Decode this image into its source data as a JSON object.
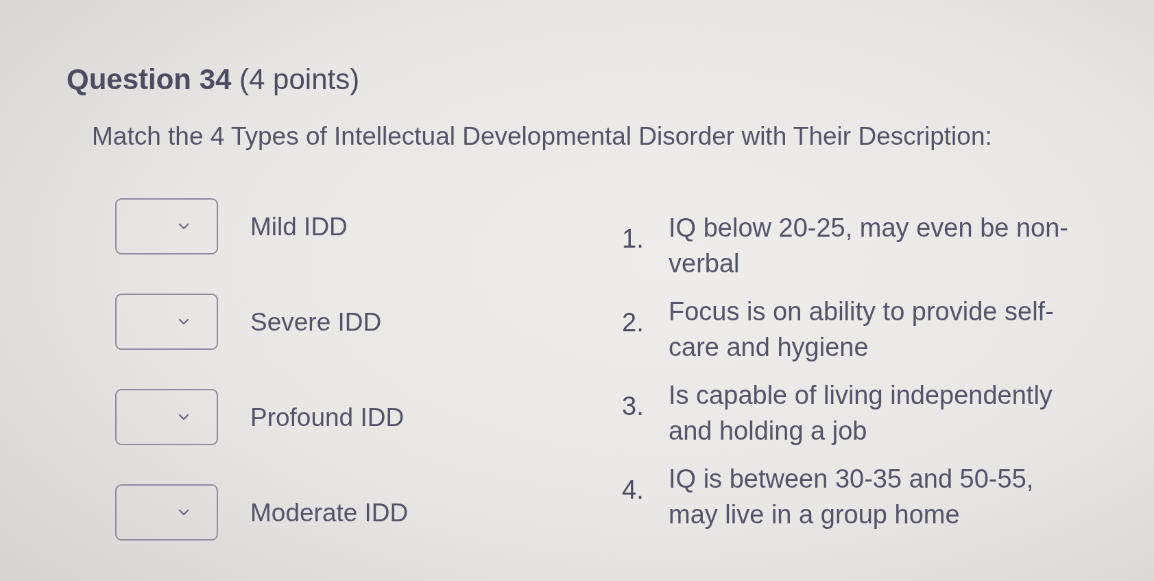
{
  "question": {
    "title": "**Question 34** (4 points)",
    "prompt": "Match the 4 Types of Intellectual Developmental Disorder with Their Description:"
  },
  "matching": {
    "items": [
      {
        "label": "Mild IDD"
      },
      {
        "label": "Severe IDD"
      },
      {
        "label": "Profound IDD"
      },
      {
        "label": "Moderate IDD"
      }
    ],
    "answers": [
      {
        "number": "1.",
        "text": "IQ below 20-25, may even be non-verbal"
      },
      {
        "number": "2.",
        "text": "Focus is on ability to provide self-care and hygiene"
      },
      {
        "number": "3.",
        "text": "Is capable of living independently and holding a job"
      },
      {
        "number": "4.",
        "text": "IQ is between 30-35 and 50-55, may live in a group home"
      }
    ]
  }
}
